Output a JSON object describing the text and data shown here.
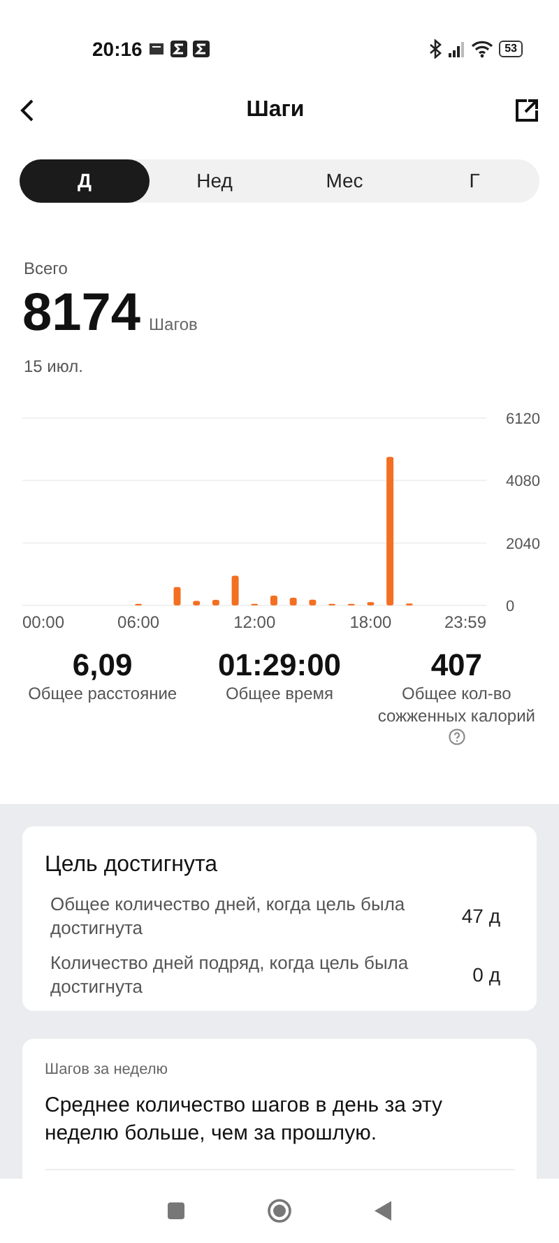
{
  "status_bar": {
    "time": "20:16",
    "battery": "53"
  },
  "header": {
    "title": "Шаги"
  },
  "tabs": [
    {
      "label": "Д",
      "selected": true
    },
    {
      "label": "Нед",
      "selected": false
    },
    {
      "label": "Мес",
      "selected": false
    },
    {
      "label": "Г",
      "selected": false
    }
  ],
  "summary": {
    "label": "Всего",
    "value": "8174",
    "unit": "Шагов",
    "date": "15 июл.",
    "chart_data": {
      "type": "bar",
      "x": [
        6,
        8,
        9,
        10,
        11,
        12,
        13,
        14,
        15,
        16,
        17,
        18,
        19,
        20
      ],
      "series": [
        {
          "color": "#f36f21",
          "values": [
            50,
            600,
            150,
            180,
            970,
            50,
            320,
            250,
            190,
            50,
            50,
            110,
            4850,
            60
          ]
        }
      ],
      "xlim": [
        0,
        23.98
      ],
      "ylim": [
        0,
        6120
      ],
      "xticks": [
        {
          "value": 0,
          "label": "00:00"
        },
        {
          "value": 6,
          "label": "06:00"
        },
        {
          "value": 12,
          "label": "12:00"
        },
        {
          "value": 18,
          "label": "18:00"
        },
        {
          "value": 23.98,
          "label": "23:59"
        }
      ],
      "yticks": [
        0,
        2040,
        4080,
        6120
      ]
    }
  },
  "stats": [
    {
      "value": "6,09",
      "label": "Общее расстояние",
      "help": false
    },
    {
      "value": "01:29:00",
      "label": "Общее время",
      "help": false
    },
    {
      "value": "407",
      "label": "Общее кол-во сожженных калорий",
      "help": true
    }
  ],
  "goal_card": {
    "title": "Цель достигнута",
    "rows": [
      {
        "label": "Общее количество дней, когда цель была достигнута",
        "value": "47 д"
      },
      {
        "label": "Количество дней подряд, когда цель была достигнута",
        "value": "0 д"
      }
    ]
  },
  "week_card": {
    "title": "Шагов за неделю",
    "text": "Среднее количество шагов в день за эту неделю больше, чем за прошлую."
  }
}
